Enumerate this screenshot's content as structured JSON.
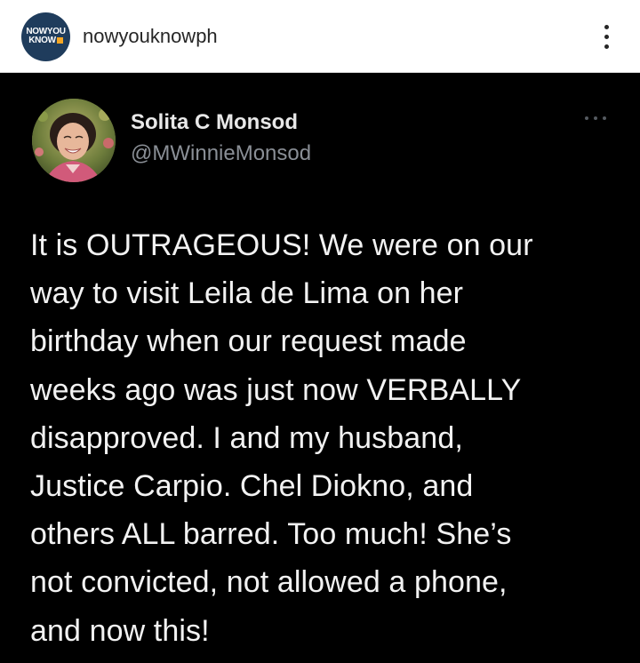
{
  "post_header": {
    "account_logo": {
      "line1": "NOWYOU",
      "line2": "KNOW"
    },
    "username": "nowyouknowph",
    "more_icon": "vertical-ellipsis-icon"
  },
  "tweet": {
    "author_name": "Solita C Monsod",
    "author_handle": "@MWinnieMonsod",
    "more_icon": "horizontal-ellipsis-icon",
    "text_lines": [
      "It is OUTRAGEOUS! We were on our",
      "way to visit Leila de Lima on her",
      "birthday when our request made",
      "weeks ago was just now VERBALLY",
      "disapproved. I and my husband,",
      "Justice Carpio. Chel Diokno, and",
      "others ALL barred. Too much! She’s",
      "not convicted, not allowed a phone,",
      "and now this!"
    ]
  },
  "colors": {
    "header_background": "#ffffff",
    "tweet_background": "#000000",
    "logo_background": "#1f3c5c",
    "logo_accent": "#f5a623",
    "tweet_text": "#f2f2f2",
    "handle_text": "#8a8f96"
  }
}
